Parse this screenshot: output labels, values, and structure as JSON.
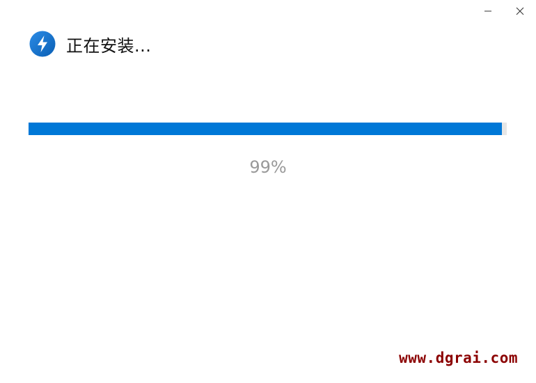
{
  "window": {
    "controls": {
      "minimize_icon": "minimize-icon",
      "close_icon": "close-icon"
    }
  },
  "header": {
    "icon": "lightning-bolt-icon",
    "title": "正在安装..."
  },
  "progress": {
    "value_fraction": 0.99,
    "label": "99%",
    "color": "#0078d7"
  },
  "watermark": {
    "text": "www.dgrai.com",
    "color": "#8b0000"
  }
}
